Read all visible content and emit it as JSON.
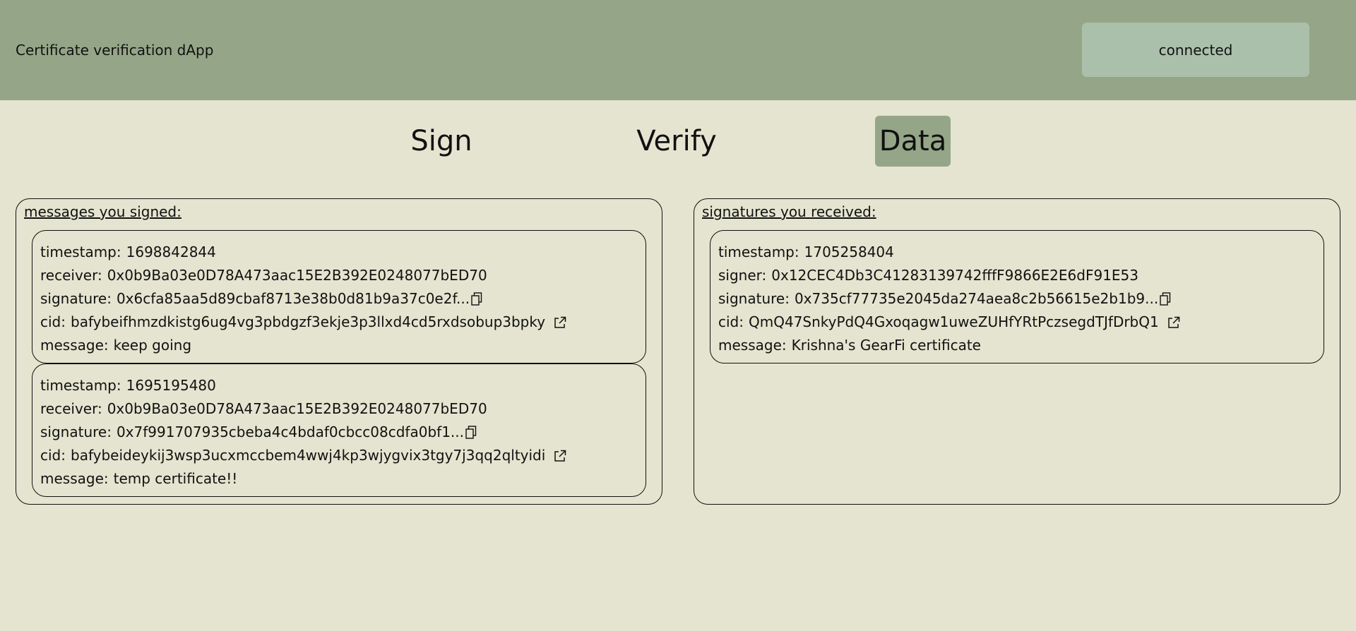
{
  "header": {
    "title": "Certificate verification dApp",
    "connect_label": "connected"
  },
  "tabs": [
    {
      "label": "Sign",
      "active": false
    },
    {
      "label": "Verify",
      "active": false
    },
    {
      "label": "Data",
      "active": true
    }
  ],
  "colors": {
    "header_bg": "#95a688",
    "page_bg": "#e4e4d0",
    "button_bg": "#abc0ab",
    "active_tab_bg": "#95a688"
  },
  "icons": {
    "copy": "copy-icon",
    "external_link": "external-link-icon"
  },
  "labels": {
    "timestamp": "timestamp:",
    "receiver": "receiver:",
    "signer": "signer:",
    "signature": "signature:",
    "cid": "cid:",
    "message": "message:"
  },
  "signed": {
    "title": "messages you signed:",
    "items": [
      {
        "timestamp": "1698842844",
        "receiver": "0x0b9Ba03e0D78A473aac15E2B392E0248077bED70",
        "signature": "0x6cfa85aa5d89cbaf8713e38b0d81b9a37c0e2f...",
        "cid": "bafybeifhmzdkistg6ug4vg3pbdgzf3ekje3p3llxd4cd5rxdsobup3bpky",
        "message": "keep going"
      },
      {
        "timestamp": "1695195480",
        "receiver": "0x0b9Ba03e0D78A473aac15E2B392E0248077bED70",
        "signature": "0x7f991707935cbeba4c4bdaf0cbcc08cdfa0bf1...",
        "cid": "bafybeideykij3wsp3ucxmccbem4wwj4kp3wjygvix3tgy7j3qq2qltyidi",
        "message": "temp certificate!!"
      }
    ]
  },
  "received": {
    "title": "signatures you received:",
    "items": [
      {
        "timestamp": "1705258404",
        "signer": "0x12CEC4Db3C41283139742fffF9866E2E6dF91E53",
        "signature": "0x735cf77735e2045da274aea8c2b56615e2b1b9...",
        "cid": "QmQ47SnkyPdQ4Gxoqagw1uweZUHfYRtPczsegdTJfDrbQ1",
        "message": "Krishna's GearFi certificate"
      }
    ]
  }
}
